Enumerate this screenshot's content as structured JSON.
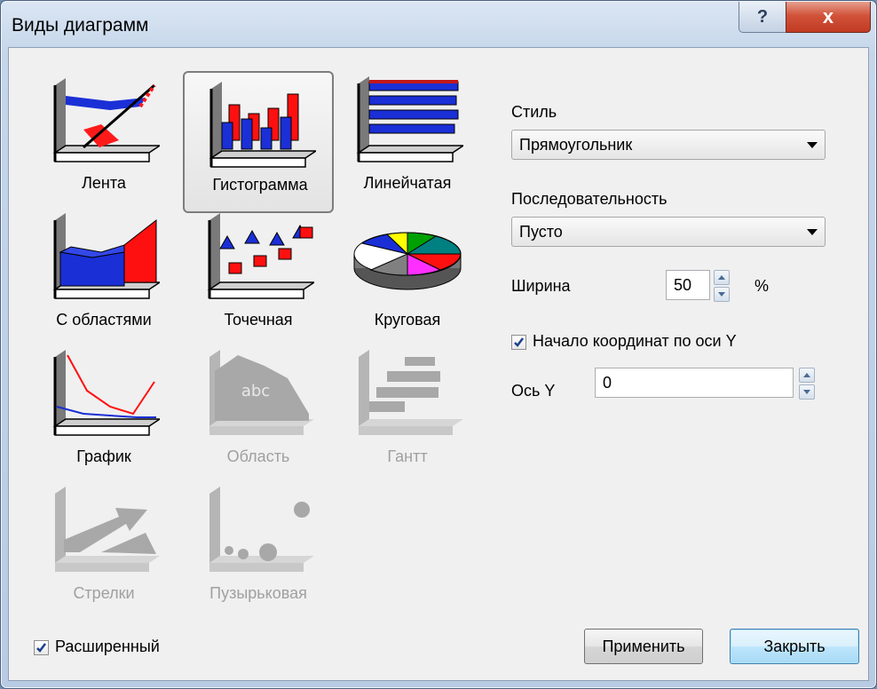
{
  "window": {
    "title": "Виды диаграмм",
    "help_glyph": "?",
    "close_glyph": "x"
  },
  "chart_types": [
    {
      "label": "Лента",
      "icon": "ribbon-chart-icon",
      "enabled": true,
      "selected": false
    },
    {
      "label": "Гистограмма",
      "icon": "histogram-chart-icon",
      "enabled": true,
      "selected": true
    },
    {
      "label": "Линейчатая",
      "icon": "bar-chart-icon",
      "enabled": true,
      "selected": false
    },
    {
      "label": "С областями",
      "icon": "area-3d-chart-icon",
      "enabled": true,
      "selected": false
    },
    {
      "label": "Точечная",
      "icon": "point-chart-icon",
      "enabled": true,
      "selected": false
    },
    {
      "label": "Круговая",
      "icon": "pie-chart-icon",
      "enabled": true,
      "selected": false
    },
    {
      "label": "График",
      "icon": "line-chart-icon",
      "enabled": true,
      "selected": false
    },
    {
      "label": "Область",
      "icon": "area-chart-icon",
      "enabled": false,
      "selected": false,
      "icon_text": "abc"
    },
    {
      "label": "Гантт",
      "icon": "gantt-chart-icon",
      "enabled": false,
      "selected": false
    },
    {
      "label": "Стрелки",
      "icon": "arrow-chart-icon",
      "enabled": false,
      "selected": false
    },
    {
      "label": "Пузырьковая",
      "icon": "bubble-chart-icon",
      "enabled": false,
      "selected": false
    }
  ],
  "options": {
    "style_label": "Стиль",
    "style_value": "Прямоугольник",
    "sequence_label": "Последовательность",
    "sequence_value": "Пусто",
    "width_label": "Ширина",
    "width_value": "50",
    "width_unit": "%",
    "origin_checkbox_label": "Начало координат по оси Y",
    "origin_checked": true,
    "y_axis_label": "Ось Y",
    "y_axis_value": "0"
  },
  "footer": {
    "extended_label": "Расширенный",
    "extended_checked": true,
    "apply_label": "Применить",
    "close_label": "Закрыть"
  },
  "colors": {
    "accent_blue": "#0000ff",
    "accent_red": "#ff0000",
    "disabled_gray": "#a0a0a0"
  }
}
